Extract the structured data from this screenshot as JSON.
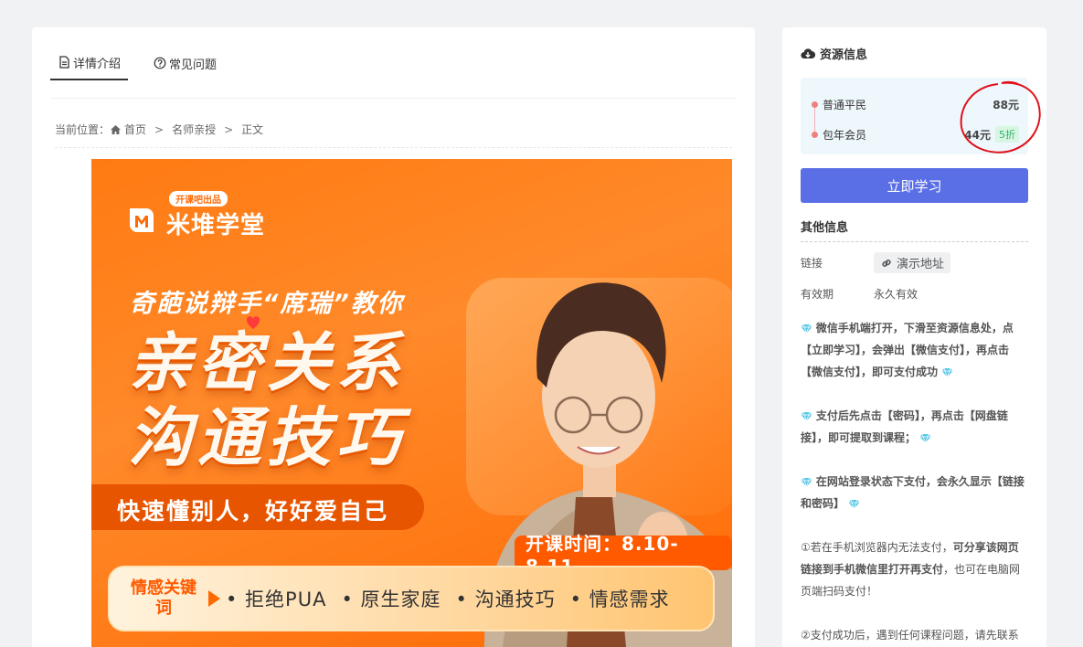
{
  "tabs": [
    {
      "label": "详情介绍",
      "icon": "document-icon",
      "active": true
    },
    {
      "label": "常见问题",
      "icon": "question-circle-icon",
      "active": false
    }
  ],
  "breadcrumb": {
    "prefix": "当前位置：",
    "home": "首页",
    "category": "名师亲授",
    "current": "正文",
    "separator": ">"
  },
  "banner": {
    "brand_tag": "开课吧出品",
    "brand_name": "米堆学堂",
    "topline": "奇葩说辩手“席瑞”教你",
    "title_line1": "亲密关系",
    "title_line2": "沟通技巧",
    "subtitle": "快速懂别人，好好爱自己",
    "date": "开课时间：8.10-8.11",
    "keyword_label": "情感关键词",
    "keywords": [
      "• 拒绝PUA",
      "• 原生家庭",
      "• 沟通技巧",
      "• 情感需求"
    ]
  },
  "resource": {
    "title": "资源信息",
    "prices": [
      {
        "name": "普通平民",
        "price": "88元",
        "discount": ""
      },
      {
        "name": "包年会员",
        "price": "44元",
        "discount": "5折"
      }
    ],
    "buy_button": "立即学习"
  },
  "other": {
    "title": "其他信息",
    "link_label": "链接",
    "link_text": "演示地址",
    "validity_label": "有效期",
    "validity_value": "永久有效"
  },
  "notes": {
    "n1": "微信手机端打开，下滑至资源信息处，点【立即学习】，会弹出【微信支付】，再点击【微信支付】，即可支付成功",
    "n2": "支付后先点击【密码】，再点击【网盘链接】，即可提取到课程；",
    "n3": "在网站登录状态下支付，会永久显示【链接和密码】",
    "n4a": "①若在手机浏览器内无法支付，",
    "n4b": "可分享该网页链接到手机微信里打开再支付",
    "n4c": "，也可在电脑网页端扫码支付！",
    "n5": "②支付成功后，遇到任何课程问题，请先联系"
  },
  "colors": {
    "accent": "#5a6ee6",
    "banner_orange": "#ff7a12",
    "discount_green": "#2fb36a",
    "annotation_red": "#e0101a"
  }
}
